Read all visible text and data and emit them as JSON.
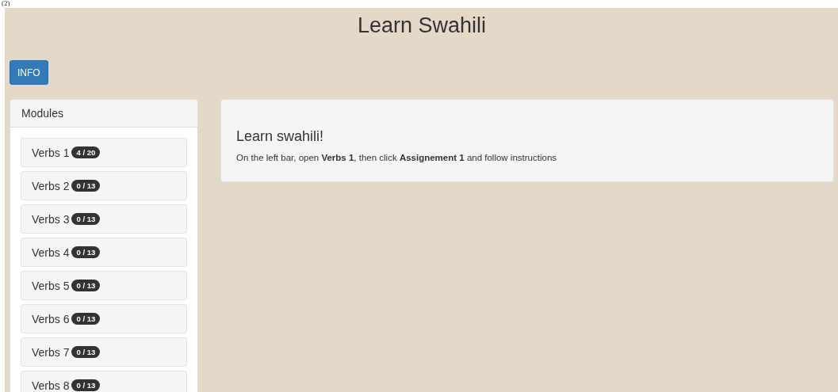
{
  "figure_label": "(2)",
  "title": "Learn Swahili",
  "info_button": "INFO",
  "sidebar": {
    "heading": "Modules",
    "items": [
      {
        "label": "Verbs 1",
        "badge": "4 / 20"
      },
      {
        "label": "Verbs 2",
        "badge": "0 / 13"
      },
      {
        "label": "Verbs 3",
        "badge": "0 / 13"
      },
      {
        "label": "Verbs 4",
        "badge": "0 / 13"
      },
      {
        "label": "Verbs 5",
        "badge": "0 / 13"
      },
      {
        "label": "Verbs 6",
        "badge": "0 / 13"
      },
      {
        "label": "Verbs 7",
        "badge": "0 / 13"
      },
      {
        "label": "Verbs 8",
        "badge": "0 / 13"
      }
    ]
  },
  "main": {
    "heading": "Learn swahili!",
    "text": "On the left bar, open **Verbs 1**, then click **Assignement 1** and follow instructions"
  }
}
